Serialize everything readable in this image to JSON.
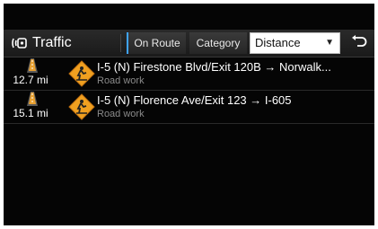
{
  "header": {
    "title": "Traffic",
    "title_icon": "traffic-info-icon",
    "on_route_label": "On Route",
    "category_label": "Category",
    "sort_select": {
      "value": "Distance"
    },
    "back_icon": "back-arrow-icon"
  },
  "incidents": [
    {
      "distance": "12.7 mi",
      "road": "I-5 (N) Firestone Blvd/Exit 120B → Norwalk...",
      "type": "Road work",
      "icon": "road-work-sign-icon"
    },
    {
      "distance": "15.1 mi",
      "road": "I-5 (N) Florence Ave/Exit 123 → I-605",
      "type": "Road work",
      "icon": "road-work-sign-icon"
    }
  ],
  "colors": {
    "background": "#050505",
    "header": "#222222",
    "accent": "#3fa4ff",
    "sign": "#f0a020",
    "subtext": "#8a8a8a"
  }
}
